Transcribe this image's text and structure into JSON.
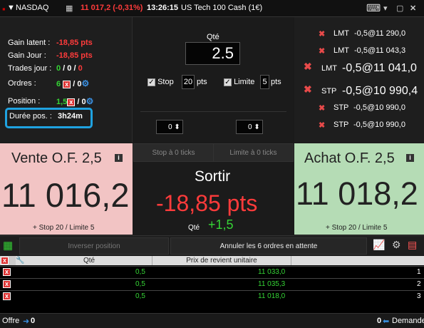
{
  "titlebar": {
    "market": "NASDAQ",
    "price": "11 017,2 (-0,31%)",
    "time": "13:26:15",
    "instrument": "US Tech 100 Cash (1€)",
    "icons": [
      "dropdown-arrow-icon",
      "chart-icon",
      "keyboard-icon",
      "close-icon",
      "minimize-icon",
      "maximize-icon"
    ]
  },
  "info": {
    "gain_latent_label": "Gain latent :",
    "gain_latent": "-18,85 pts",
    "gain_jour_label": "Gain Jour :",
    "gain_jour": "-18,85 pts",
    "trades_label": "Trades jour :",
    "trades": [
      "0",
      "0",
      "0"
    ],
    "ordres_label": "Ordres :",
    "ordres_val": "6",
    "ordres_zero": "0",
    "position_label": "Position :",
    "position_val": "1,5",
    "position_zero": "0",
    "duree_label": "Durée pos. :",
    "duree": "3h24m"
  },
  "qty": {
    "label": "Qté",
    "value": "2.5",
    "stop_label": "Stop",
    "stop_value": "20",
    "limit_label": "Limite",
    "limit_value": "5",
    "pts": "pts",
    "spin_left": "0",
    "spin_right": "0"
  },
  "orders": [
    {
      "type": "LMT",
      "text": "-0,5@11 290,0",
      "big": false
    },
    {
      "type": "LMT",
      "text": "-0,5@11 043,3",
      "big": false
    },
    {
      "type": "LMT",
      "text": "-0,5@11 041,0",
      "big": true
    },
    {
      "type": "STP",
      "text": "-0,5@10 990,4",
      "big": true
    },
    {
      "type": "STP",
      "text": "-0,5@10 990,0",
      "big": false
    },
    {
      "type": "STP",
      "text": "-0,5@10 990,0",
      "big": false
    }
  ],
  "sell": {
    "title": "Vente O.F. 2,5",
    "price": "11 016,2",
    "sub": "+ Stop 20 / Limite 5"
  },
  "buy": {
    "title": "Achat O.F. 2,5",
    "price": "11 018,2",
    "sub": "+ Stop 20 / Limite 5"
  },
  "exit": {
    "stop_tick": "Stop à 0 ticks",
    "limit_tick": "Limite à 0 ticks",
    "label": "Sortir",
    "pnl": "-18,85 pts",
    "qte_label": "Qté",
    "qte": "+1,5"
  },
  "toolbar": {
    "reverse": "Inverser position",
    "cancel": "Annuler les 6 ordres en attente"
  },
  "table": {
    "headers": [
      "Qté",
      "Prix de revient unitaire"
    ],
    "rows": [
      {
        "qty": "0,5",
        "price": "11 033,0",
        "n": "1"
      },
      {
        "qty": "0,5",
        "price": "11 035,3",
        "n": "2"
      },
      {
        "qty": "0,5",
        "price": "11 018,0",
        "n": "3"
      }
    ]
  },
  "status": {
    "offre_label": "Offre",
    "offre_val": "0",
    "demande_val": "0",
    "demande_label": "Demande"
  },
  "colors": {
    "red": "#ff3b3b",
    "green": "#35d435",
    "sell_bg": "#f2c4c4",
    "buy_bg": "#b5dcb5",
    "highlight": "#1fa2e0"
  }
}
